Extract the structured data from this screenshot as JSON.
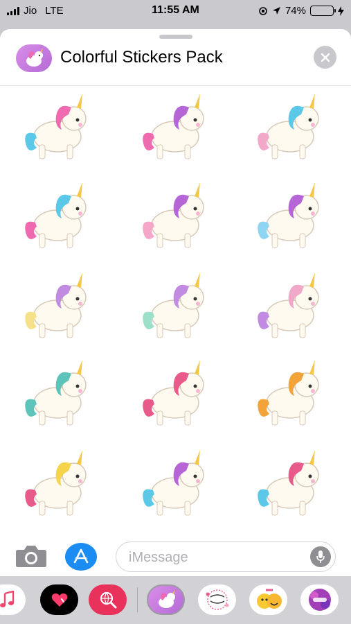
{
  "status_bar": {
    "carrier": "Jio",
    "network": "LTE",
    "time": "11:55 AM",
    "battery_percent": "74%",
    "battery_level": 0.74
  },
  "header": {
    "title": "Colorful Stickers Pack",
    "icon": "unicorn-sticker-icon"
  },
  "stickers": [
    {
      "name": "sticker-unicorn-hearts-flying",
      "row": 1,
      "col": 1,
      "mane": "#f06ab0",
      "accent": "#5cc8e8"
    },
    {
      "name": "sticker-unicorn-hearts-standing",
      "row": 1,
      "col": 2,
      "mane": "#b565d6",
      "accent": "#f06ab0"
    },
    {
      "name": "sticker-unicorn-on-cloud",
      "row": 1,
      "col": 3,
      "mane": "#5cc8e8",
      "accent": "#f2a8c9"
    },
    {
      "name": "sticker-unicorn-moon-star",
      "row": 2,
      "col": 1,
      "mane": "#5cc8e8",
      "accent": "#f06ab0"
    },
    {
      "name": "sticker-unicorn-moon-wink",
      "row": 2,
      "col": 2,
      "mane": "#b565d6",
      "accent": "#f6a6c8"
    },
    {
      "name": "sticker-unicorn-sleeping-cloud",
      "row": 2,
      "col": 3,
      "mane": "#b565d6",
      "accent": "#8fd4f2"
    },
    {
      "name": "sticker-unicorn-pastel-lying",
      "row": 3,
      "col": 1,
      "mane": "#c08be0",
      "accent": "#f7e08a"
    },
    {
      "name": "sticker-unicorn-pastel-walking",
      "row": 3,
      "col": 2,
      "mane": "#c08be0",
      "accent": "#9de0c9"
    },
    {
      "name": "sticker-unicorn-pastel-sitting",
      "row": 3,
      "col": 3,
      "mane": "#f2a8c9",
      "accent": "#c08be0"
    },
    {
      "name": "sticker-unicorn-mint",
      "row": 4,
      "col": 1,
      "mane": "#5cc4b8",
      "accent": "#5cc4b8"
    },
    {
      "name": "sticker-unicorn-pink-standing",
      "row": 4,
      "col": 2,
      "mane": "#e85a8a",
      "accent": "#e85a8a"
    },
    {
      "name": "sticker-unicorn-orange-rearing",
      "row": 4,
      "col": 3,
      "mane": "#f2a33a",
      "accent": "#f2a33a"
    },
    {
      "name": "sticker-unicorn-rainbow-prancing",
      "row": 5,
      "col": 1,
      "mane": "#f5d34b",
      "accent": "#e85a8a"
    },
    {
      "name": "sticker-unicorn-rainbow-head",
      "row": 5,
      "col": 2,
      "mane": "#b565d6",
      "accent": "#5cc8e8"
    },
    {
      "name": "sticker-unicorn-rainbow-sleeping",
      "row": 5,
      "col": 3,
      "mane": "#e85a8a",
      "accent": "#5cc8e8"
    }
  ],
  "message_bar": {
    "placeholder": "iMessage",
    "camera_icon": "camera-icon",
    "appstore_icon": "app-store-icon",
    "mic_icon": "microphone-icon"
  },
  "dock": {
    "items": [
      {
        "name": "dock-music-app",
        "icon": "music-note-icon"
      },
      {
        "name": "dock-digital-touch-app",
        "icon": "heart-icon"
      },
      {
        "name": "dock-search-images-app",
        "icon": "globe-search-icon"
      },
      {
        "name": "dock-colorful-stickers-app",
        "icon": "unicorn-sticker-icon"
      },
      {
        "name": "dock-beautiful-day-stickers-app",
        "icon": "beautiful-day-sticker-icon"
      },
      {
        "name": "dock-3d-emoji-app",
        "icon": "emoji-face-icon"
      },
      {
        "name": "dock-cool-dude-app",
        "icon": "cool-dude-sticker-icon"
      }
    ]
  },
  "colors": {
    "status_bg": "#c9c9ce",
    "sheet_bg": "#ffffff",
    "accent_blue": "#1a8cf2",
    "dock_bg": "#d1d1d6"
  }
}
